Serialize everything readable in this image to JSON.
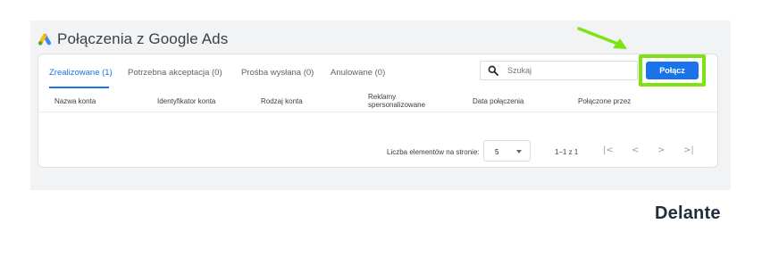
{
  "header": {
    "title": "Połączenia z Google Ads",
    "logo_icon": "google-ads-icon"
  },
  "tabs": [
    {
      "label": "Zrealizowane (1)",
      "active": true
    },
    {
      "label": "Potrzebna akceptacja (0)",
      "active": false
    },
    {
      "label": "Prośba wysłana (0)",
      "active": false
    },
    {
      "label": "Anulowane (0)",
      "active": false
    }
  ],
  "search": {
    "placeholder": "Szukaj",
    "icon": "search-icon"
  },
  "actions": {
    "connect_label": "Połącz"
  },
  "table": {
    "columns": [
      "Nazwa konta",
      "Identyfikator konta",
      "Rodzaj konta",
      "Reklamy spersonalizowane",
      "Data połączenia",
      "Połączone przez"
    ],
    "columns_split": {
      "ads_line1": "Reklamy",
      "ads_line2": "spersonalizowane"
    },
    "rows": []
  },
  "pagination": {
    "items_per_page_label": "Liczba elementów na stronie:",
    "page_size": "5",
    "range": "1–1 z 1",
    "first": "|<",
    "prev": "<",
    "next": ">",
    "last": ">|"
  },
  "branding": {
    "name": "Delante"
  },
  "colors": {
    "accent": "#1a73e8",
    "highlight": "#7ee312",
    "panel": "#f1f3f4"
  }
}
